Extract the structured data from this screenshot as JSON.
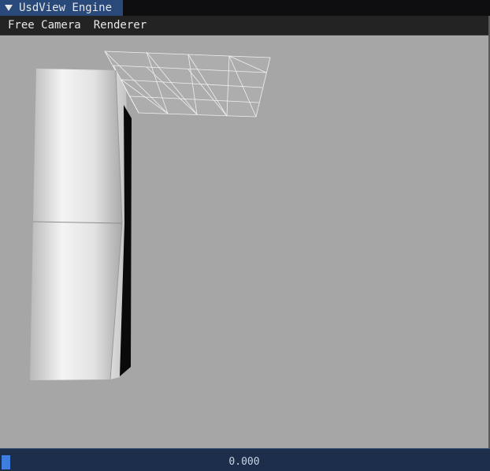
{
  "window": {
    "title": "UsdView Engine",
    "collapse_icon": "triangle-down-icon"
  },
  "menubar": {
    "items": [
      {
        "label": "Free Camera"
      },
      {
        "label": "Renderer"
      }
    ]
  },
  "timeline": {
    "value": "0.000",
    "slider_fraction": 0.0
  },
  "colors": {
    "title_tab": "#29497a",
    "viewport_background": "#a6a6a6",
    "slider_grab": "#3d7ee0",
    "statusbar": "#1c2e4a"
  }
}
